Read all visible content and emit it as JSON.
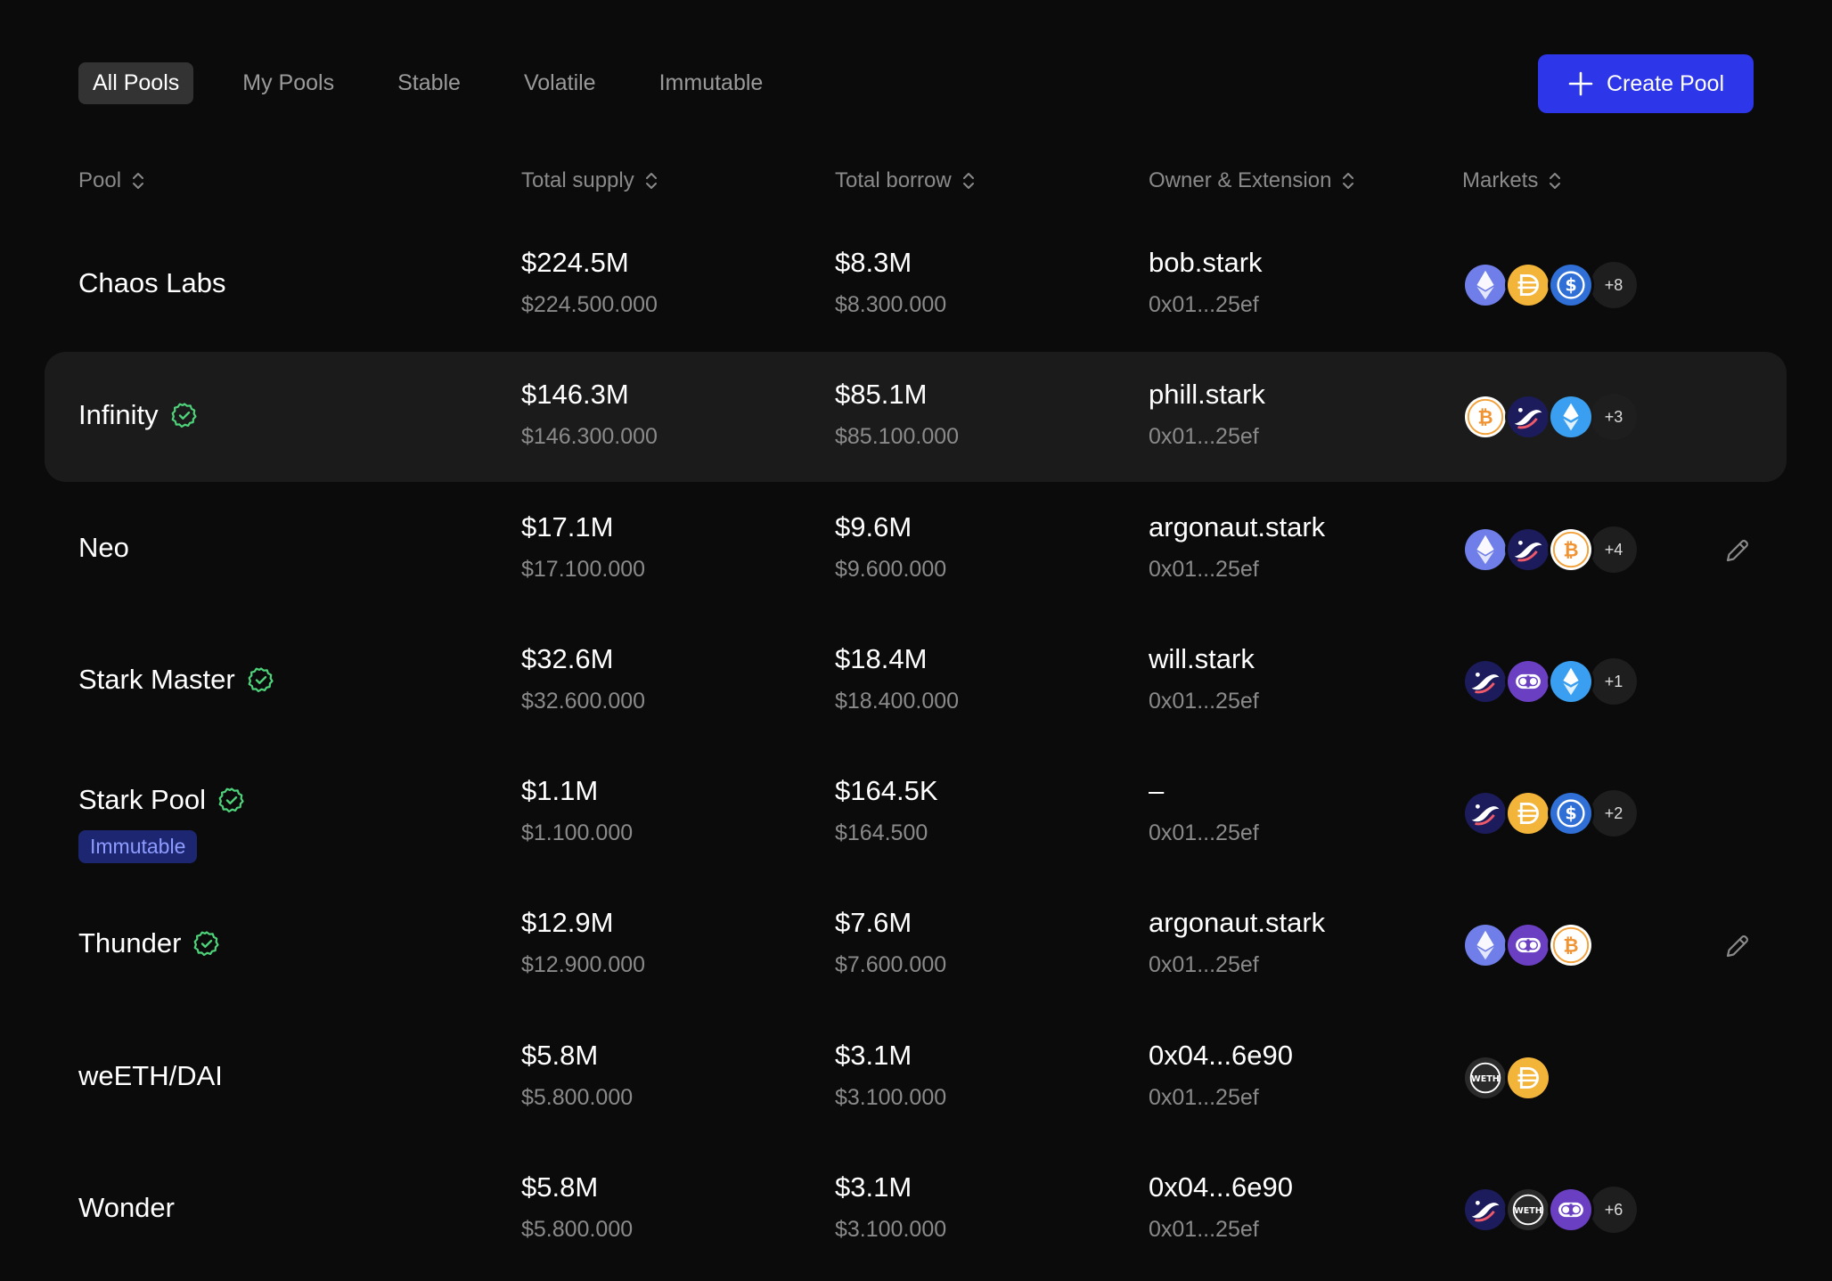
{
  "tabs": [
    "All Pools",
    "My Pools",
    "Stable",
    "Volatile",
    "Immutable"
  ],
  "create_button": {
    "label": "Create Pool",
    "color": "#2d36e8"
  },
  "columns": [
    "Pool",
    "Total supply",
    "Total borrow",
    "Owner & Extension",
    "Markets"
  ],
  "rows": [
    {
      "name": "Chaos Labs",
      "verified": false,
      "immutable": "",
      "supply": "$224.5M",
      "supply_exact": "$224.500.000",
      "borrow": "$8.3M",
      "borrow_exact": "$8.300.000",
      "owner": "bob.stark",
      "extension": "0x01...25ef",
      "tokens": [
        "eth-icon",
        "dai-icon",
        "usdc-icon"
      ],
      "extra": "+8",
      "editable": false
    },
    {
      "name": "Infinity",
      "verified": true,
      "immutable": "",
      "supply": "$146.3M",
      "supply_exact": "$146.300.000",
      "borrow": "$85.1M",
      "borrow_exact": "$85.100.000",
      "owner": "phill.stark",
      "extension": "0x01...25ef",
      "tokens": [
        "btc-icon",
        "strk-icon",
        "steth-icon"
      ],
      "extra": "+3",
      "editable": false,
      "highlighted": true
    },
    {
      "name": "Neo",
      "verified": false,
      "immutable": "",
      "supply": "$17.1M",
      "supply_exact": "$17.100.000",
      "borrow": "$9.6M",
      "borrow_exact": "$9.600.000",
      "owner": "argonaut.stark",
      "extension": "0x01...25ef",
      "tokens": [
        "eth-icon",
        "strk-icon",
        "btc-icon"
      ],
      "extra": "+4",
      "editable": true
    },
    {
      "name": "Stark Master",
      "verified": true,
      "immutable": "",
      "supply": "$32.6M",
      "supply_exact": "$32.600.000",
      "borrow": "$18.4M",
      "borrow_exact": "$18.400.000",
      "owner": "will.stark",
      "extension": "0x01...25ef",
      "tokens": [
        "strk-icon",
        "loop-icon",
        "steth-icon"
      ],
      "extra": "+1",
      "editable": false
    },
    {
      "name": "Stark Pool",
      "verified": true,
      "immutable": "Immutable",
      "supply": "$1.1M",
      "supply_exact": "$1.100.000",
      "borrow": "$164.5K",
      "borrow_exact": "$164.500",
      "owner": "–",
      "extension": "0x01...25ef",
      "tokens": [
        "strk-icon",
        "dai-icon",
        "usdc-icon"
      ],
      "extra": "+2",
      "editable": false
    },
    {
      "name": "Thunder",
      "verified": true,
      "immutable": "",
      "supply": "$12.9M",
      "supply_exact": "$12.900.000",
      "borrow": "$7.6M",
      "borrow_exact": "$7.600.000",
      "owner": "argonaut.stark",
      "extension": "0x01...25ef",
      "tokens": [
        "eth-icon",
        "loop-icon",
        "btc-icon"
      ],
      "extra": "",
      "editable": true
    },
    {
      "name": "weETH/DAI",
      "verified": false,
      "immutable": "",
      "supply": "$5.8M",
      "supply_exact": "$5.800.000",
      "borrow": "$3.1M",
      "borrow_exact": "$3.100.000",
      "owner": "0x04...6e90",
      "extension": "0x01...25ef",
      "tokens": [
        "weth-icon",
        "dai-icon"
      ],
      "extra": "",
      "editable": false
    },
    {
      "name": "Wonder",
      "verified": false,
      "immutable": "",
      "supply": "$5.8M",
      "supply_exact": "$5.800.000",
      "borrow": "$3.1M",
      "borrow_exact": "$3.100.000",
      "owner": "0x04...6e90",
      "extension": "0x01...25ef",
      "tokens": [
        "strk-icon",
        "weth-icon",
        "loop-icon"
      ],
      "extra": "+6",
      "editable": false
    }
  ],
  "token_labels": {
    "weth-icon": "WETH"
  },
  "colors": {
    "background": "#0b0b0b",
    "highlight_row": "#1b1b1b",
    "verified": "#4fd37a",
    "immutable_badge": "#1d2670",
    "immutable_text": "#8e9cff"
  }
}
